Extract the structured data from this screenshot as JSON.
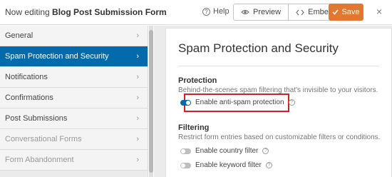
{
  "topbar": {
    "editing_prefix": "Now editing",
    "form_name": "Blog Post Submission Form",
    "help_label": "Help",
    "preview_label": "Preview",
    "embed_label": "Embed",
    "save_label": "Save",
    "close_glyph": "×",
    "save_color": "#e27730"
  },
  "sidebar": {
    "items": [
      {
        "label": "General",
        "state": "normal"
      },
      {
        "label": "Spam Protection and Security",
        "state": "active"
      },
      {
        "label": "Notifications",
        "state": "normal"
      },
      {
        "label": "Confirmations",
        "state": "normal"
      },
      {
        "label": "Post Submissions",
        "state": "normal"
      },
      {
        "label": "Conversational Forms",
        "state": "muted"
      },
      {
        "label": "Form Abandonment",
        "state": "muted"
      }
    ],
    "chevron": "›",
    "active_color": "#036aab"
  },
  "panel": {
    "title": "Spam Protection and Security",
    "protection": {
      "title": "Protection",
      "description": "Behind-the-scenes spam filtering that's invisible to your visitors.",
      "toggle_label": "Enable anti-spam protection",
      "toggle_on": true
    },
    "filtering": {
      "title": "Filtering",
      "description": "Restrict form entries based on customizable filters or conditions.",
      "country_label": "Enable country filter",
      "country_on": false,
      "keyword_label": "Enable keyword filter",
      "keyword_on": false
    },
    "help_glyph": "?"
  }
}
